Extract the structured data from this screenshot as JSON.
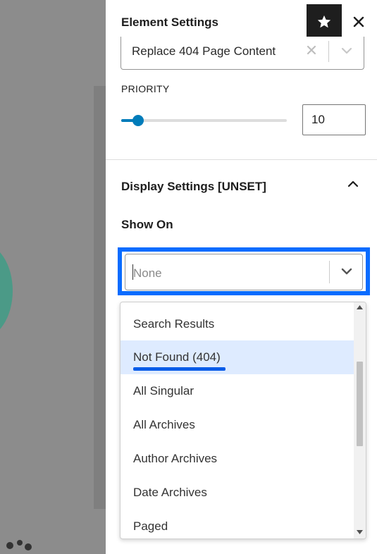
{
  "panel": {
    "title": "Element Settings",
    "icons": {
      "star": "star-icon",
      "close": "close-icon"
    }
  },
  "hook_select": {
    "value": "Replace 404 Page Content"
  },
  "priority": {
    "label": "PRIORITY",
    "value": "10",
    "slider_fraction": 0.1
  },
  "display_settings": {
    "title": "Display Settings [UNSET]",
    "expanded": true
  },
  "show_on": {
    "label": "Show On",
    "placeholder": "None",
    "options": [
      {
        "label": "Search Results",
        "highlighted": false
      },
      {
        "label": "Not Found (404)",
        "highlighted": true
      },
      {
        "label": "All Singular",
        "highlighted": false
      },
      {
        "label": "All Archives",
        "highlighted": false
      },
      {
        "label": "Author Archives",
        "highlighted": false
      },
      {
        "label": "Date Archives",
        "highlighted": false
      },
      {
        "label": "Paged",
        "highlighted": false
      }
    ]
  },
  "colors": {
    "accent": "#007cba",
    "focus_ring": "#0a6cff",
    "highlight": "#deebff",
    "dark": "#1e1e1e"
  }
}
